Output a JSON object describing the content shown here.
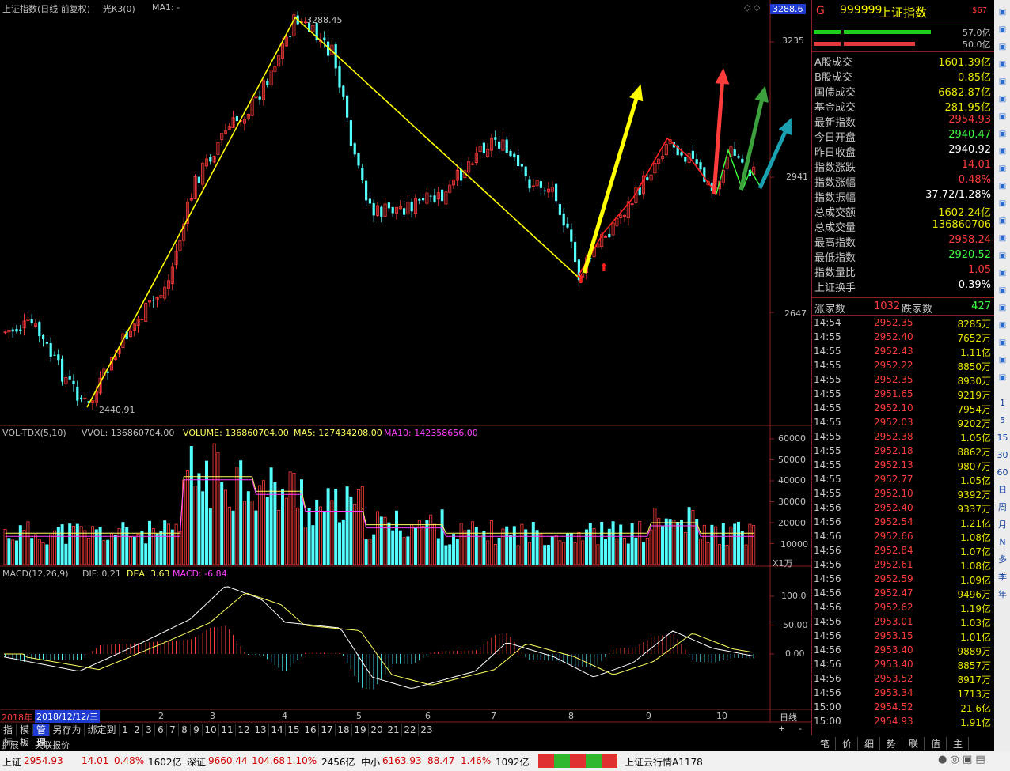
{
  "header": {
    "title": "上证指数(日线 前复权)",
    "indicator": "光K3(0)",
    "ma": "MA1: -",
    "price_box": "3288.6"
  },
  "price_axis": [
    "3235",
    "2941",
    "2647"
  ],
  "annotations": {
    "high": "3288.45",
    "low": "2440.91"
  },
  "vol_header": {
    "name": "VOL-TDX(5,10)",
    "vvol": "VVOL: 136860704.00",
    "volume": "VOLUME: 136860704.00",
    "ma5": "MA5: 127434208.00",
    "ma10": "MA10: 142358656.00"
  },
  "vol_axis": [
    "60000",
    "50000",
    "40000",
    "30000",
    "20000",
    "10000"
  ],
  "vol_unit": "X1万",
  "macd_header": {
    "name": "MACD(12,26,9)",
    "dif": "DIF: 0.21",
    "dea": "DEA: 3.63",
    "macd": "MACD: -6.84"
  },
  "macd_axis": [
    "100.0",
    "50.00",
    "0.00"
  ],
  "date_axis": {
    "year": "2018年",
    "selected": "2018/12/12/三",
    "months": [
      "2",
      "3",
      "4",
      "5",
      "6",
      "7",
      "8",
      "9",
      "10"
    ],
    "right": "日线"
  },
  "bottom_tabs": [
    "指标",
    "模板",
    "管理",
    "另存为",
    "绑定到",
    "1",
    "2",
    "3",
    "6",
    "7",
    "8",
    "9",
    "10",
    "11",
    "12",
    "13",
    "14",
    "15",
    "16",
    "17",
    "18",
    "19",
    "20",
    "21",
    "22",
    "23"
  ],
  "bottom_tabs2": [
    "扩展^",
    "关联报价"
  ],
  "panel": {
    "code": "999999",
    "name": "上证指数",
    "tag": "$67",
    "letter": "G",
    "bar1": "57.0亿",
    "bar2": "50.0亿",
    "rows": [
      {
        "label": "A股成交",
        "value": "1601.39亿",
        "color": "#e6e600"
      },
      {
        "label": "B股成交",
        "value": "0.85亿",
        "color": "#e6e600"
      },
      {
        "label": "国债成交",
        "value": "6682.87亿",
        "color": "#e6e600"
      },
      {
        "label": "基金成交",
        "value": "281.95亿",
        "color": "#e6e600"
      },
      {
        "label": "最新指数",
        "value": "2954.93",
        "color": "#ff3c3c"
      },
      {
        "label": "今日开盘",
        "value": "2940.47",
        "color": "#3cff3c"
      },
      {
        "label": "昨日收盘",
        "value": "2940.92",
        "color": "#ffffff"
      },
      {
        "label": "指数涨跌",
        "value": "14.01",
        "color": "#ff3c3c"
      },
      {
        "label": "指数涨幅",
        "value": "0.48%",
        "color": "#ff3c3c"
      },
      {
        "label": "指数振幅",
        "value": "37.72/1.28%",
        "color": "#ffffff"
      },
      {
        "label": "总成交额",
        "value": "1602.24亿",
        "color": "#e6e600"
      },
      {
        "label": "总成交量",
        "value": "136860706",
        "color": "#e6e600"
      },
      {
        "label": "最高指数",
        "value": "2958.24",
        "color": "#ff3c3c"
      },
      {
        "label": "最低指数",
        "value": "2920.52",
        "color": "#3cff3c"
      },
      {
        "label": "指数量比",
        "value": "1.05",
        "color": "#ff3c3c"
      },
      {
        "label": "上证换手",
        "value": "0.39%",
        "color": "#ffffff"
      }
    ],
    "updown": {
      "up_label": "涨家数",
      "up": "1032",
      "down_label": "跌家数",
      "down": "427"
    },
    "ticks": [
      [
        "14:54",
        "2952.35",
        "8285万"
      ],
      [
        "14:55",
        "2952.40",
        "7652万"
      ],
      [
        "14:55",
        "2952.43",
        "1.11亿"
      ],
      [
        "14:55",
        "2952.22",
        "8850万"
      ],
      [
        "14:55",
        "2952.35",
        "8930万"
      ],
      [
        "14:55",
        "2951.65",
        "9219万"
      ],
      [
        "14:55",
        "2952.10",
        "7954万"
      ],
      [
        "14:55",
        "2952.03",
        "9202万"
      ],
      [
        "14:55",
        "2952.38",
        "1.05亿"
      ],
      [
        "14:55",
        "2952.18",
        "8862万"
      ],
      [
        "14:55",
        "2952.13",
        "9807万"
      ],
      [
        "14:55",
        "2952.77",
        "1.05亿"
      ],
      [
        "14:55",
        "2952.10",
        "9392万"
      ],
      [
        "14:56",
        "2952.40",
        "9337万"
      ],
      [
        "14:56",
        "2952.54",
        "1.21亿"
      ],
      [
        "14:56",
        "2952.66",
        "1.08亿"
      ],
      [
        "14:56",
        "2952.84",
        "1.07亿"
      ],
      [
        "14:56",
        "2952.61",
        "1.08亿"
      ],
      [
        "14:56",
        "2952.59",
        "1.09亿"
      ],
      [
        "14:56",
        "2952.47",
        "9496万"
      ],
      [
        "14:56",
        "2952.62",
        "1.19亿"
      ],
      [
        "14:56",
        "2953.01",
        "1.03亿"
      ],
      [
        "14:56",
        "2953.15",
        "1.01亿"
      ],
      [
        "14:56",
        "2953.40",
        "9889万"
      ],
      [
        "14:56",
        "2953.40",
        "8857万"
      ],
      [
        "14:56",
        "2953.52",
        "8917万"
      ],
      [
        "14:56",
        "2953.34",
        "1713万"
      ],
      [
        "15:00",
        "2954.52",
        "21.6亿"
      ],
      [
        "15:00",
        "2954.93",
        "1.91亿"
      ]
    ],
    "tabs": [
      "笔",
      "价",
      "细",
      "势",
      "联",
      "值",
      "主"
    ]
  },
  "toolbar": [
    "1",
    "5",
    "15",
    "30",
    "60",
    "日",
    "周",
    "月",
    "N",
    "多",
    "季",
    "年"
  ],
  "status": {
    "sh_name": "上证",
    "sh_price": "2954.93",
    "sh_chg": "14.01",
    "sh_pct": "0.48%",
    "sh_amt": "1602亿",
    "sz_name": "深证",
    "sz_price": "9660.44",
    "sz_chg": "104.68",
    "sz_pct": "1.10%",
    "sz_amt": "2456亿",
    "zx_name": "中小",
    "zx_price": "6163.93",
    "zx_chg": "88.47",
    "zx_pct": "1.46%",
    "zx_amt": "1092亿",
    "cloud": "上证云行情A1178"
  },
  "chart_data": {
    "type": "candlestick",
    "title": "上证指数(日线 前复权)",
    "price_ticks": [
      3235,
      2941,
      2647
    ],
    "high": 3288.45,
    "low": 2440.91,
    "trend_lines": [
      {
        "from": "2018-02 low",
        "to": "2018-04 high",
        "values": [
          2440.91,
          3288.45
        ],
        "color": "#ffff00"
      },
      {
        "from": "2018-04 high",
        "to": "2018-08 low",
        "values": [
          3288.45,
          2653
        ],
        "color": "#ffff00"
      }
    ],
    "volume_ticks": [
      60000,
      50000,
      40000,
      30000,
      20000,
      10000
    ],
    "macd_ticks": [
      100,
      50,
      0
    ],
    "macd_last": {
      "dif": 0.21,
      "dea": 3.63,
      "macd": -6.84
    },
    "colors": {
      "up": "#ff3c3c",
      "down": "#54ffff",
      "ma5": "#ffff60",
      "ma10": "#ff40ff"
    }
  }
}
